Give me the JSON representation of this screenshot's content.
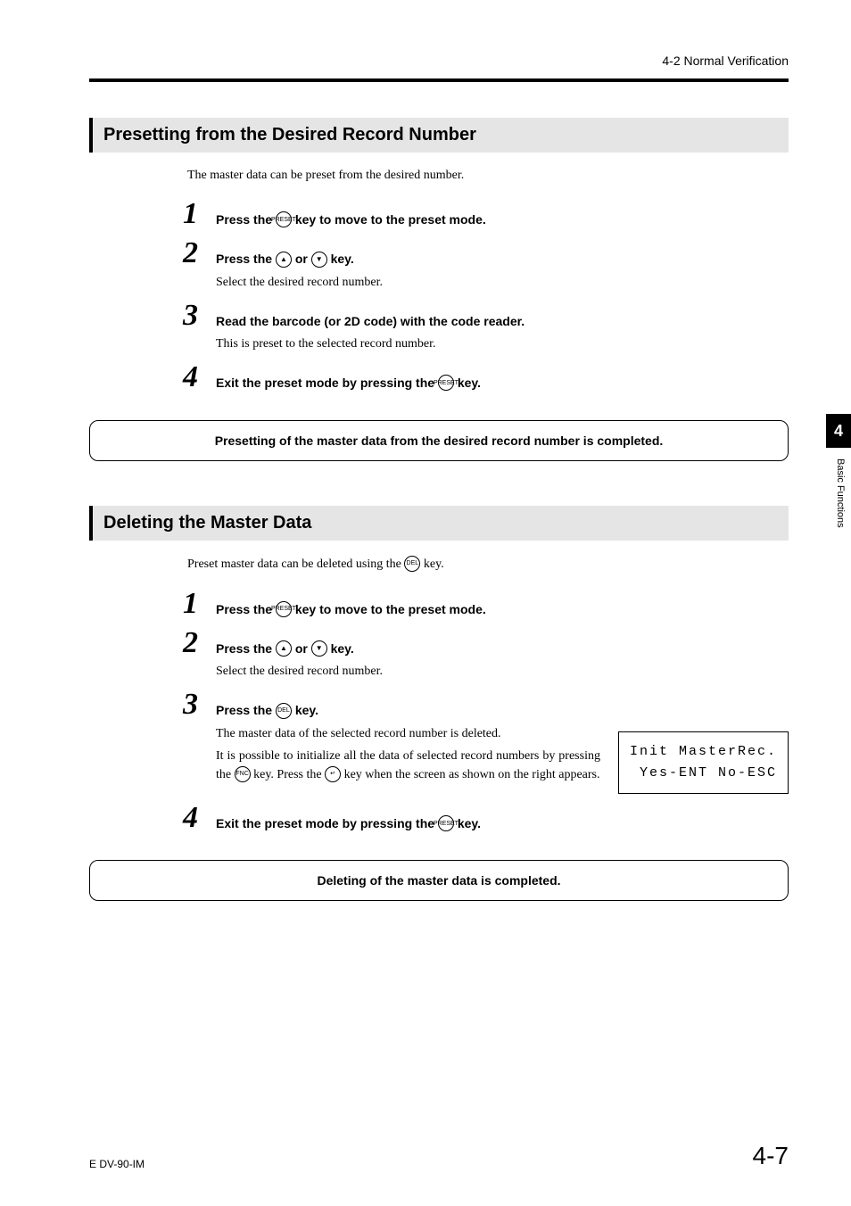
{
  "header": {
    "section_label": "4-2  Normal Verification"
  },
  "side": {
    "tab_number": "4",
    "label": "Basic Functions"
  },
  "section1": {
    "heading": "Presetting from the Desired Record Number",
    "intro": "The master data can be preset from the desired number.",
    "steps": [
      {
        "num": "1",
        "title_before": "Press the ",
        "key": "PRESET",
        "title_after": " key to move to the preset mode."
      },
      {
        "num": "2",
        "title_before": "Press the ",
        "key1": "▲",
        "mid": " or ",
        "key2": "▼",
        "title_after": " key.",
        "desc": "Select the desired record number."
      },
      {
        "num": "3",
        "title": "Read the barcode (or 2D code) with the code reader.",
        "desc": "This is preset to the selected record number."
      },
      {
        "num": "4",
        "title_before": "Exit the preset mode by pressing the ",
        "key": "PRESET",
        "title_after": " key."
      }
    ],
    "completion": "Presetting of the master data from the desired record number is completed."
  },
  "section2": {
    "heading": "Deleting the Master Data",
    "intro_before": "Preset master data can be deleted using the ",
    "intro_key": "DEL",
    "intro_after": " key.",
    "steps": [
      {
        "num": "1",
        "title_before": "Press the ",
        "key": "PRESET",
        "title_after": " key to move to the preset mode."
      },
      {
        "num": "2",
        "title_before": "Press the ",
        "key1": "▲",
        "mid": " or ",
        "key2": "▼",
        "title_after": " key.",
        "desc": "Select the desired record number."
      },
      {
        "num": "3",
        "title_before": "Press the ",
        "key": "DEL",
        "title_after": " key.",
        "desc_line1": "The master data of the selected record number is deleted.",
        "desc_line2_before": "It is possible to initialize all the data of selected record numbers by pressing the ",
        "desc_key1": "FNC",
        "desc_mid": " key. Press the ",
        "desc_key2": "↵",
        "desc_line2_after": " key when the screen as shown on the right appears.",
        "lcd_line1": "Init MasterRec.",
        "lcd_line2": " Yes-ENT No-ESC"
      },
      {
        "num": "4",
        "title_before": "Exit the preset mode by pressing the ",
        "key": "PRESET",
        "title_after": " key."
      }
    ],
    "completion": "Deleting of the master data is completed."
  },
  "footer": {
    "left": "E DV-90-IM",
    "right": "4-7"
  }
}
